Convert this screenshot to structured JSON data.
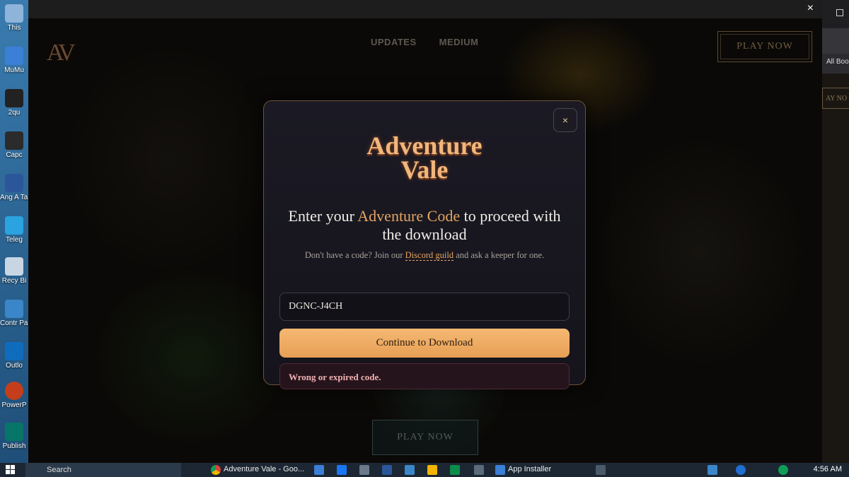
{
  "desktop_icons": [
    {
      "label": "This",
      "color": "#8fb4d9"
    },
    {
      "label": "MuMu",
      "color": "#3b7fd6"
    },
    {
      "label": "2qu",
      "color": "#222222"
    },
    {
      "label": "Capc",
      "color": "#2b2b2b"
    },
    {
      "label": "Ang A Talam",
      "color": "#2b579a"
    },
    {
      "label": "Teleg",
      "color": "#2aa3e0"
    },
    {
      "label": "Recy Bi",
      "color": "#c8d6e4"
    },
    {
      "label": "Contr Pane",
      "color": "#3a86c8"
    },
    {
      "label": "Outlo",
      "color": "#0f6cbd"
    },
    {
      "label": "PowerP",
      "color": "#c43e1c"
    },
    {
      "label": "Publish",
      "color": "#077568"
    }
  ],
  "window": {
    "close_glyph": "×"
  },
  "browser_strip": {
    "bookmarks": "All Boo",
    "button_fragment": "AY NO"
  },
  "site": {
    "logo": "AV",
    "nav": [
      "UPDATES",
      "MEDIUM"
    ],
    "play_top": "PLAY NOW",
    "play_bottom": "PLAY NOW"
  },
  "modal": {
    "close_glyph": "×",
    "logo_line1": "Adventure",
    "logo_line2": "Vale",
    "heading_pre": "Enter your ",
    "heading_accent": "Adventure Code",
    "heading_post": " to proceed with the download",
    "sub_pre": "Don't have a code? Join our ",
    "sub_link": "Discord guild",
    "sub_post": " and ask a keeper for one.",
    "code_value": "DGNC-J4CH",
    "continue_label": "Continue to Download",
    "error_text": "Wrong or expired code."
  },
  "taskbar": {
    "search_label": "Search",
    "chrome_item": "Adventure Vale - Goo...",
    "installer_item": "App Installer",
    "clock": "4:56 AM"
  },
  "colors": {
    "accent": "#e6a461",
    "button": "#f0ae68",
    "error_text": "#f0b2b2",
    "modal_border": "#6e5236"
  }
}
